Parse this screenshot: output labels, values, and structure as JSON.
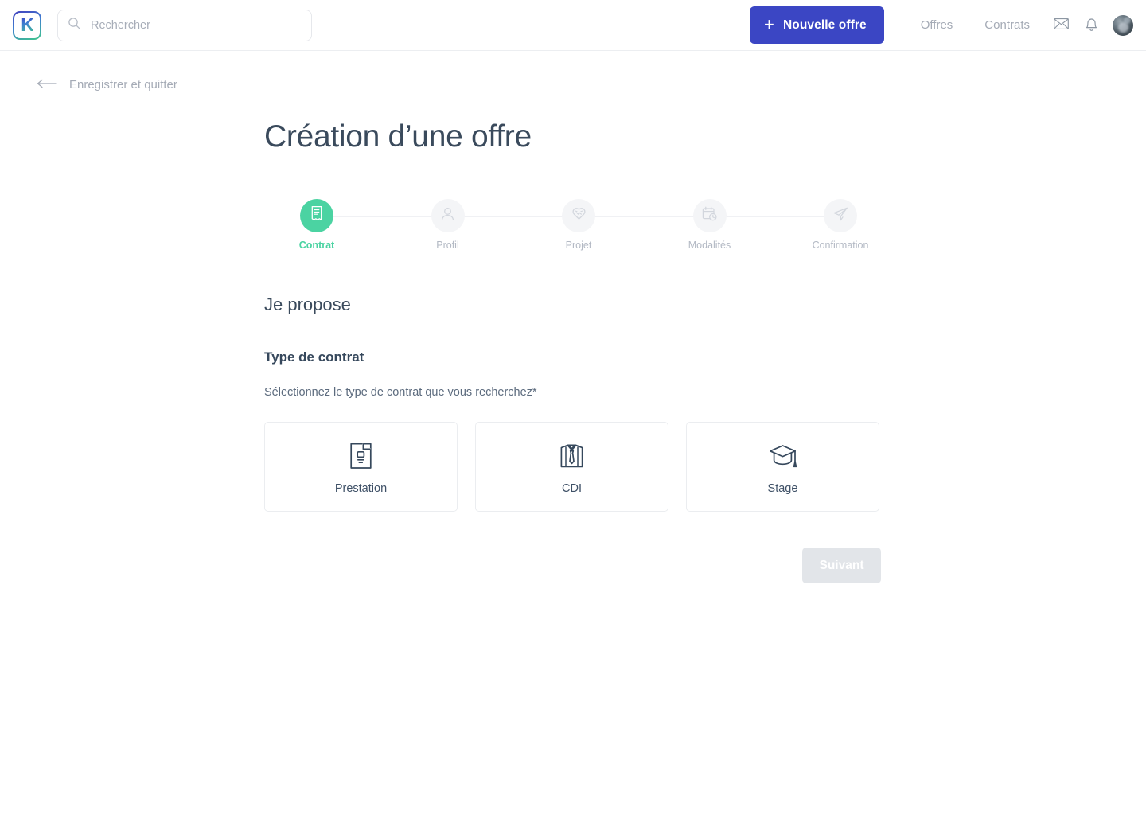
{
  "header": {
    "logo_letter": "K",
    "logo_name": "kalanso-logo",
    "search": {
      "placeholder": "Rechercher",
      "value": ""
    },
    "new_offer_button": "Nouvelle offre",
    "nav": [
      {
        "label": "Offres"
      },
      {
        "label": "Contrats"
      }
    ],
    "icons": [
      {
        "name": "mail-icon"
      },
      {
        "name": "bell-icon"
      }
    ],
    "avatar_alt": "Profil utilisateur"
  },
  "back_link": {
    "label": "Enregistrer et quitter"
  },
  "page": {
    "title": "Création d’une offre",
    "section_heading": "Je propose",
    "field_title": "Type de contrat",
    "field_help": "Sélectionnez le type de contrat que vous recherchez*"
  },
  "stepper": {
    "active_index": 0,
    "steps": [
      {
        "label": "Contrat",
        "icon": "document-icon"
      },
      {
        "label": "Profil",
        "icon": "user-icon"
      },
      {
        "label": "Projet",
        "icon": "handshake-icon"
      },
      {
        "label": "Modalités",
        "icon": "calendar-clock-icon"
      },
      {
        "label": "Confirmation",
        "icon": "paper-plane-icon"
      }
    ]
  },
  "contract_types": [
    {
      "label": "Prestation",
      "icon": "contract-document-icon"
    },
    {
      "label": "CDI",
      "icon": "shirt-tie-icon"
    },
    {
      "label": "Stage",
      "icon": "graduation-cap-icon"
    }
  ],
  "actions": {
    "next_label": "Suivant",
    "next_disabled": true
  },
  "colors": {
    "accent_green": "#4bd3a2",
    "brand_blue": "#3b46c4",
    "title_slate": "#3a4a5c",
    "muted_gray": "#a5abb6"
  }
}
